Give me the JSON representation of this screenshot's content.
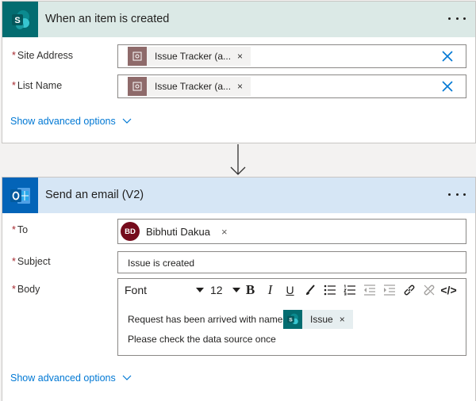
{
  "trigger": {
    "title": "When an item is created",
    "fields": [
      {
        "label": "Site Address",
        "token": "Issue Tracker (a...",
        "remove": "×"
      },
      {
        "label": "List Name",
        "token": "Issue Tracker (a...",
        "remove": "×"
      }
    ],
    "required_mark": "*",
    "advanced": "Show advanced options"
  },
  "action": {
    "title": "Send an email (V2)",
    "required_mark": "*",
    "to": {
      "label": "To",
      "initials": "BD",
      "name": "Bibhuti Dakua",
      "remove": "×"
    },
    "subject": {
      "label": "Subject",
      "value": "Issue is created"
    },
    "body": {
      "label": "Body",
      "font": "Font",
      "size": "12",
      "line1": "Request has been arrived with name",
      "line2": "Please check the data source once",
      "token": "Issue",
      "token_remove": "×"
    },
    "advanced": "Show advanced options"
  },
  "toolbar_glyphs": {
    "bold": "B",
    "italic": "I",
    "underline": "U",
    "code": "</>"
  },
  "colors": {
    "sharepoint": "#036c70",
    "outlook": "#0364b8",
    "link": "#0078d4",
    "avatar": "#750b1c",
    "required": "#a4262c"
  },
  "icons": [
    "sharepoint-icon",
    "outlook-icon",
    "more-options-icon",
    "clear-icon",
    "chevron-down-icon",
    "arrow-down-icon",
    "link-icon",
    "unlink-icon",
    "brush-icon"
  ]
}
